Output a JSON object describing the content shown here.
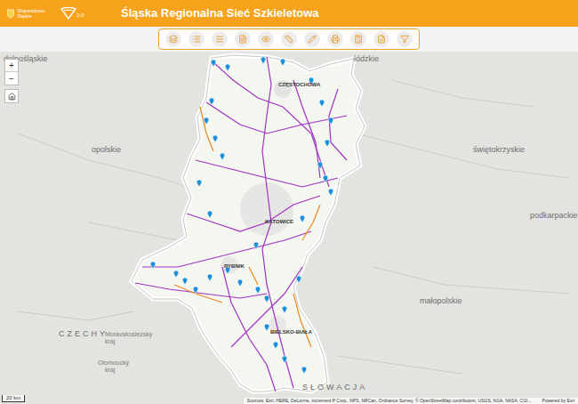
{
  "header": {
    "logo_text": "Województwo Śląskie",
    "version": "2.0",
    "title": "Śląska Regionalna Sieć Szkieletowa"
  },
  "map": {
    "zoom": {
      "in": "+",
      "out": "−"
    },
    "labels": [
      {
        "text": "dolnośląskie",
        "kind": "region"
      },
      {
        "text": "łódzkie",
        "kind": "region"
      },
      {
        "text": "opolskie",
        "kind": "region"
      },
      {
        "text": "świętokrzyskie",
        "kind": "region"
      },
      {
        "text": "podkarpackie",
        "kind": "region"
      },
      {
        "text": "małopolskie",
        "kind": "region"
      },
      {
        "text": "CZECHY",
        "kind": "country"
      },
      {
        "text": "Moravskoslezský",
        "kind": "area"
      },
      {
        "text": "kraj",
        "kind": "area"
      },
      {
        "text": "Olomoucký",
        "kind": "area"
      },
      {
        "text": "kraj",
        "kind": "area"
      },
      {
        "text": "SŁOWACJA",
        "kind": "country"
      },
      {
        "text": "CZĘSTOCHOWA",
        "kind": "city"
      },
      {
        "text": "KATOWICE",
        "kind": "city"
      },
      {
        "text": "RYBNIK",
        "kind": "city"
      },
      {
        "text": "BIELSKO-BIAŁA",
        "kind": "city"
      }
    ],
    "scale": "20 km",
    "attribution": "Sources: Esri, HERE, DeLorme, increment P Corp., NPS, NRCan, Ordnance Survey, © OpenStreetMap contributors, USGS, NGA, NASA, CGI...",
    "powered_by": "Powered by Esri"
  }
}
